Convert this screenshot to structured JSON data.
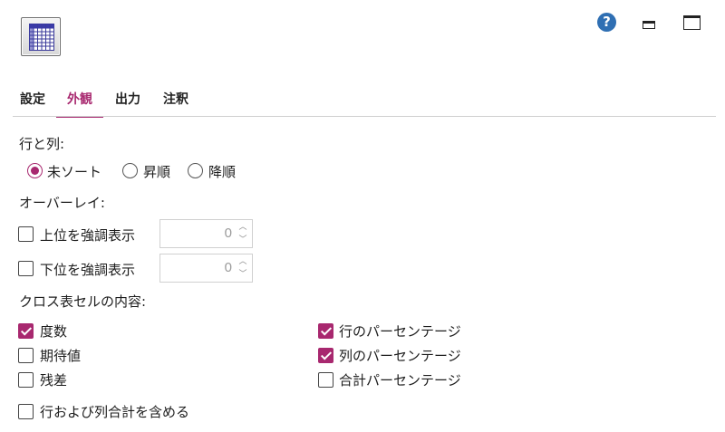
{
  "toolbar": {
    "app_icon": "table-grid-icon",
    "help_icon": "?",
    "minimize_icon": "minimize-icon",
    "maximize_icon": "maximize-icon"
  },
  "tabs": [
    {
      "label": "設定"
    },
    {
      "label": "外観",
      "active": true
    },
    {
      "label": "出力"
    },
    {
      "label": "注釈"
    }
  ],
  "rows_cols": {
    "heading": "行と列:",
    "options": [
      {
        "label": "未ソート",
        "selected": true
      },
      {
        "label": "昇順"
      },
      {
        "label": "降順"
      }
    ]
  },
  "overlay": {
    "heading": "オーバーレイ:",
    "highlight_top": {
      "label": "上位を強調表示",
      "checked": false,
      "value": "0"
    },
    "highlight_bottom": {
      "label": "下位を強調表示",
      "checked": false,
      "value": "0"
    }
  },
  "cell_contents": {
    "heading": "クロス表セルの内容:",
    "left": [
      {
        "label": "度数",
        "checked": true
      },
      {
        "label": "期待値",
        "checked": false
      },
      {
        "label": "残差",
        "checked": false
      }
    ],
    "right": [
      {
        "label": "行のパーセンテージ",
        "checked": true
      },
      {
        "label": "列のパーセンテージ",
        "checked": true
      },
      {
        "label": "合計パーセンテージ",
        "checked": false
      }
    ]
  },
  "include_totals": {
    "label": "行および列合計を含める",
    "checked": false
  },
  "colors": {
    "accent": "#a8286f",
    "help": "#2f6fb3"
  }
}
